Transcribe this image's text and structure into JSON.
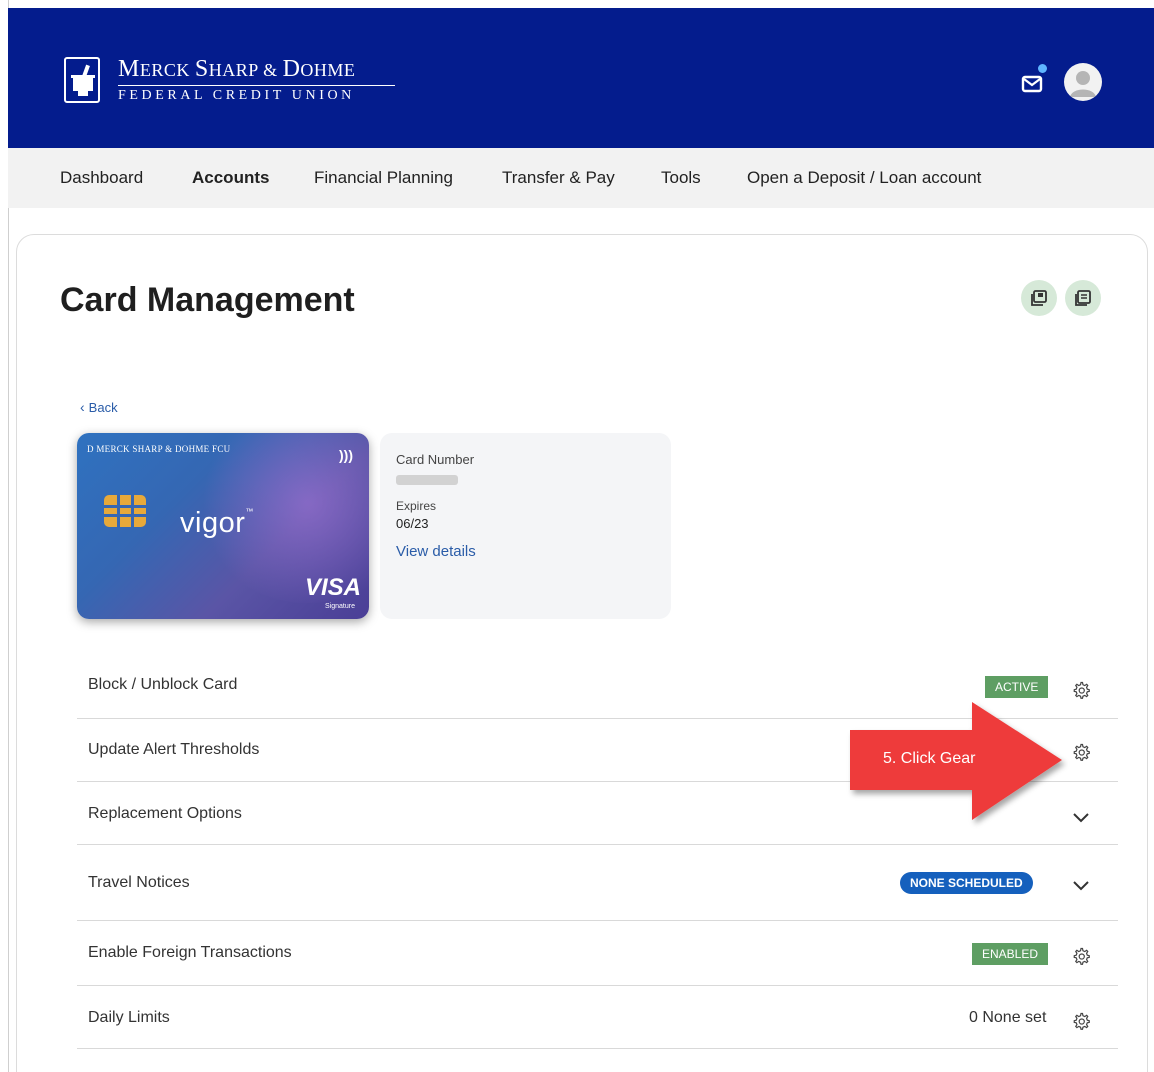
{
  "brand": {
    "name_line1_a": "M",
    "name_line1_b": "ERCK ",
    "name_line1_c": "S",
    "name_line1_d": "HARP & ",
    "name_line1_e": "D",
    "name_line1_f": "OHME",
    "name_line2": "FEDERAL CREDIT UNION",
    "header_color": "#041c8d"
  },
  "header_icons": [
    "mail-icon",
    "user-avatar-icon"
  ],
  "nav": [
    {
      "label": "Dashboard",
      "active": false
    },
    {
      "label": "Accounts",
      "active": true
    },
    {
      "label": "Financial Planning",
      "active": false
    },
    {
      "label": "Transfer & Pay",
      "active": false
    },
    {
      "label": "Tools",
      "active": false
    },
    {
      "label": "Open a Deposit / Loan account",
      "active": false
    }
  ],
  "page": {
    "title": "Card Management",
    "back": "Back",
    "toolbar_icons": [
      "save-icon",
      "print-icon"
    ]
  },
  "card": {
    "issuer": "D MERCK SHARP & DOHME FCU",
    "product": "vigor",
    "network": "VISA",
    "network_tier": "Signature",
    "number_label": "Card Number",
    "expires_label": "Expires",
    "expires_value": "06/23",
    "view_details": "View details"
  },
  "settings": [
    {
      "label": "Block / Unblock Card",
      "badge": "ACTIVE",
      "control": "gear-icon"
    },
    {
      "label": "Update Alert Thresholds",
      "control": "gear-icon"
    },
    {
      "label": "Replacement Options",
      "control": "chevron-down-icon"
    },
    {
      "label": "Travel Notices",
      "badge": "NONE  SCHEDULED",
      "control": "chevron-down-icon"
    },
    {
      "label": "Enable Foreign Transactions",
      "badge": "ENABLED",
      "control": "gear-icon"
    },
    {
      "label": "Daily Limits",
      "value": "0 None set",
      "control": "gear-icon"
    }
  ],
  "annotation": {
    "text": "5. Click Gear",
    "color": "#ee3b3b"
  },
  "colors": {
    "accent_green": "#5e9e63",
    "accent_blue": "#1560bd",
    "link": "#2a5ca8"
  }
}
